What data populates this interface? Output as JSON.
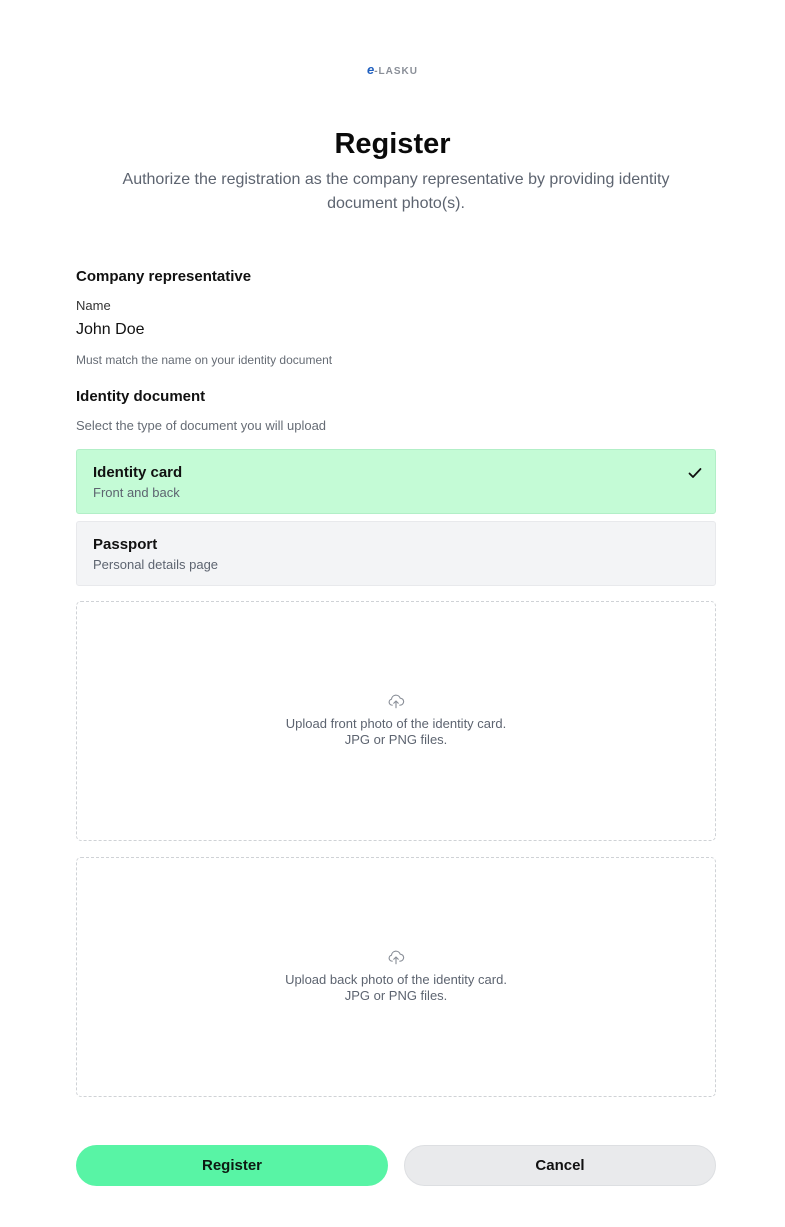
{
  "brand": {
    "logo_e": "e",
    "logo_rest": "-LASKU"
  },
  "header": {
    "title": "Register",
    "subtitle": "Authorize the registration as the company representative by providing identity document photo(s)."
  },
  "representative": {
    "section_label": "Company representative",
    "name_label": "Name",
    "name_value": "John Doe",
    "name_hint": "Must match the name on your identity document"
  },
  "identity_document": {
    "section_label": "Identity document",
    "instruction": "Select the type of document you will upload",
    "options": [
      {
        "title": "Identity card",
        "subtitle": "Front and back",
        "selected": true
      },
      {
        "title": "Passport",
        "subtitle": "Personal details page",
        "selected": false
      }
    ]
  },
  "uploads": [
    {
      "line1": "Upload front photo of the identity card.",
      "line2": "JPG or PNG files.",
      "icon": "cloud-upload-icon"
    },
    {
      "line1": "Upload back photo of the identity card.",
      "line2": "JPG or PNG files.",
      "icon": "cloud-upload-icon"
    }
  ],
  "actions": {
    "register_label": "Register",
    "cancel_label": "Cancel"
  },
  "colors": {
    "accent": "#58f4a5",
    "selected_option_bg": "#c4fbd6",
    "brand_blue": "#1f5fbf"
  }
}
